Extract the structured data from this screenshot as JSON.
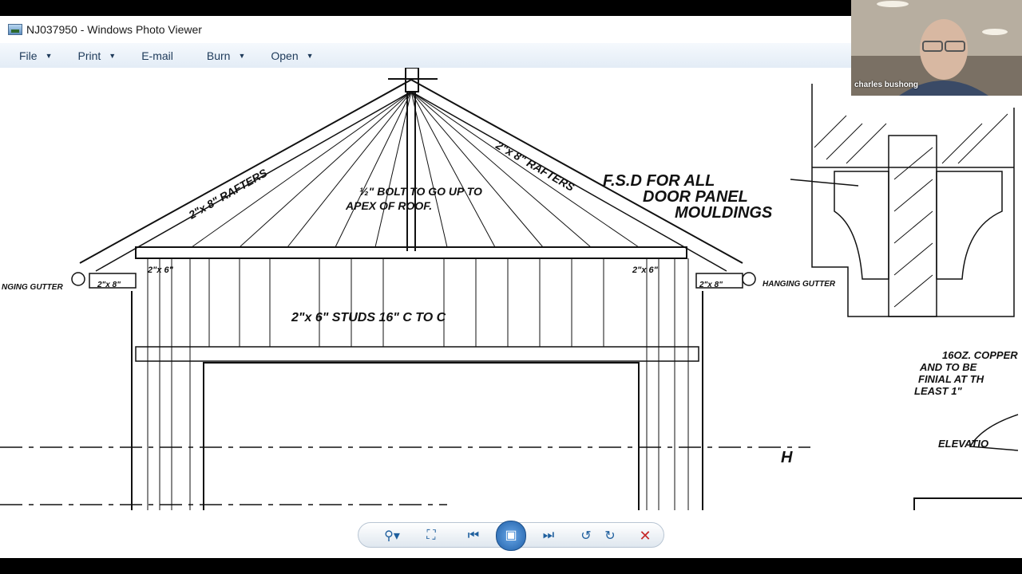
{
  "window": {
    "title": "NJ037950 - Windows Photo Viewer"
  },
  "menu": {
    "items": [
      {
        "label": "File"
      },
      {
        "label": "Print"
      },
      {
        "label": "E-mail"
      },
      {
        "label": "Burn"
      },
      {
        "label": "Open"
      }
    ]
  },
  "drawing": {
    "labels": {
      "rafters_left": "2\"x 8\" RAFTERS",
      "rafters_right": "2\"x 8\" RAFTERS",
      "bolt": "½\" BOLT TO GO UP TO",
      "apex": "APEX OF ROOF.",
      "fsd1": "F.S.D FOR ALL",
      "fsd2": "DOOR PANEL",
      "fsd3": "MOULDINGS",
      "studs": "2\"x 6\" STUDS 16\" C TO C",
      "gutter_left": "NGING GUTTER",
      "gutter_right": "HANGING GUTTER",
      "plate_left": "2\"x 6\"",
      "plate_right": "2\"x 6\"",
      "eave_left": "2\"x 8\"",
      "eave_right": "2\"x 8\"",
      "copper1": "16OZ. COPPER",
      "copper2": "AND TO BE",
      "copper3": "FINIAL AT TH",
      "copper4": "LEAST 1\"",
      "elevation": "ELEVATIO",
      "h_mark": "H"
    }
  },
  "toolbar": {
    "icons": [
      "zoom-icon",
      "actual-size-icon",
      "previous-icon",
      "slideshow-icon",
      "next-icon",
      "rotate-ccw-icon",
      "rotate-cw-icon",
      "delete-icon"
    ]
  },
  "video": {
    "name": "charles bushong"
  }
}
